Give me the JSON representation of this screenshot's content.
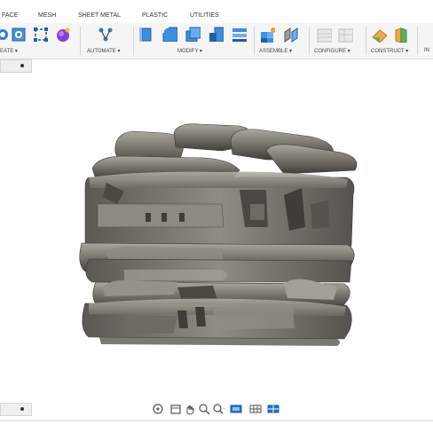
{
  "tabs": [
    "FACE",
    "MESH",
    "SHEET METAL",
    "PLASTIC",
    "UTILITIES"
  ],
  "groups": {
    "create": "EATE ▾",
    "automate": "AUTOMATE ▾",
    "modify": "MODIFY ▾",
    "assemble": "ASSEMBLE ▾",
    "configure": "CONFIGURE ▾",
    "construct": "CONSTRUCT ▾",
    "inspect": "IN"
  },
  "icons": {
    "create": [
      "sketch-icon",
      "project-icon",
      "fit-point-spline-icon",
      "form-icon"
    ],
    "automate": [
      "automate-icon"
    ],
    "modify": [
      "press-pull-icon",
      "fillet-icon",
      "shell-icon",
      "combine-icon"
    ],
    "assemble": [
      "new-component-icon",
      "joint-icon"
    ],
    "configure": [
      "configure-table-icon",
      "configure-rule-icon"
    ],
    "construct": [
      "offset-plane-icon",
      "midplane-icon"
    ],
    "navbar": [
      "orbit-icon",
      "look-at-icon",
      "pan-icon",
      "zoom-icon",
      "fit-icon",
      "display-settings-icon",
      "grid-icon",
      "viewports-icon"
    ]
  },
  "colors": {
    "model_dark": "#4a4843",
    "model_mid": "#7d7b73",
    "model_light": "#a8a69d",
    "accent_blue": "#1f6fd1"
  }
}
